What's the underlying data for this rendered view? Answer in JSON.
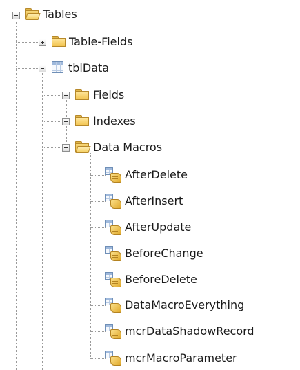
{
  "tree": {
    "root": {
      "label": "Tables",
      "icon": "folder-open-icon",
      "expanded": true
    },
    "table_fields": {
      "label": "Table-Fields",
      "icon": "folder-icon",
      "expanded": false
    },
    "tbl_data": {
      "label": "tblData",
      "icon": "table-icon",
      "expanded": true
    },
    "fields": {
      "label": "Fields",
      "icon": "folder-icon",
      "expanded": false
    },
    "indexes": {
      "label": "Indexes",
      "icon": "folder-icon",
      "expanded": false
    },
    "data_macros": {
      "label": "Data Macros",
      "icon": "folder-open-icon",
      "expanded": true
    },
    "macros": [
      {
        "label": "AfterDelete",
        "icon": "data-macro-icon"
      },
      {
        "label": "AfterInsert",
        "icon": "data-macro-icon"
      },
      {
        "label": "AfterUpdate",
        "icon": "data-macro-icon"
      },
      {
        "label": "BeforeChange",
        "icon": "data-macro-icon"
      },
      {
        "label": "BeforeDelete",
        "icon": "data-macro-icon"
      },
      {
        "label": "DataMacroEverything",
        "icon": "data-macro-icon"
      },
      {
        "label": "mcrDataShadowRecord",
        "icon": "data-macro-icon"
      },
      {
        "label": "mcrMacroParameter",
        "icon": "data-macro-icon"
      }
    ]
  }
}
